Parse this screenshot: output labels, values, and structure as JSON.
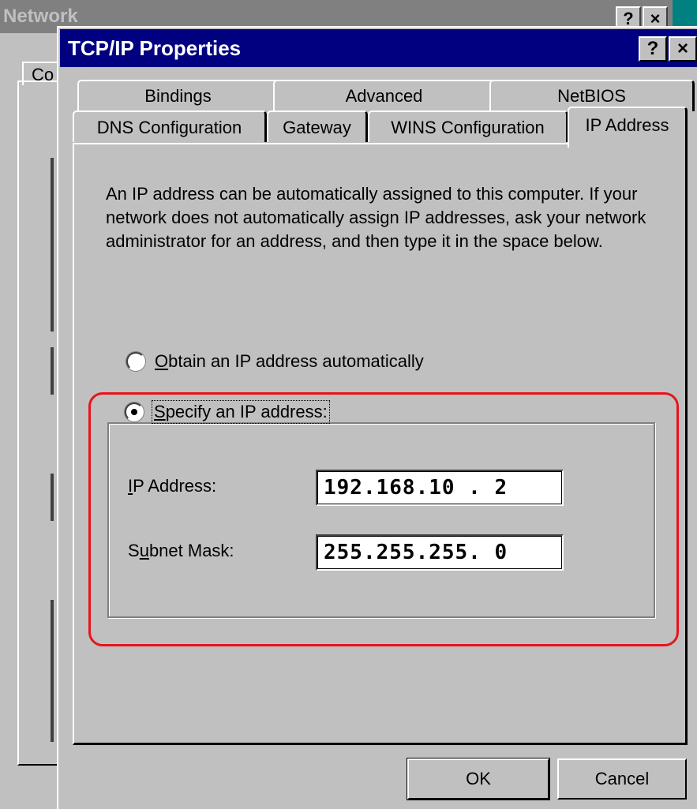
{
  "background_window": {
    "title": "Network",
    "buttons": [
      "?",
      "×"
    ],
    "tab_label": "Co"
  },
  "dialog": {
    "title": "TCP/IP Properties",
    "help_button": "?",
    "close_button": "×"
  },
  "tabs": {
    "row1": [
      "Bindings",
      "Advanced",
      "NetBIOS"
    ],
    "row2": [
      "DNS Configuration",
      "Gateway",
      "WINS Configuration"
    ],
    "active": "IP Address"
  },
  "intro_text": "An IP address can be automatically assigned to this computer. If your network does not automatically assign IP addresses, ask your network administrator for an address, and then type it in the space below.",
  "options": {
    "auto": {
      "accel": "O",
      "rest": "btain an IP address automatically",
      "selected": false
    },
    "specify": {
      "accel": "S",
      "rest": "pecify an IP address:",
      "selected": true
    }
  },
  "fields": {
    "ip_address": {
      "label_accel": "I",
      "label_rest": "P Address:",
      "value": "192.168.10 . 2"
    },
    "subnet_mask": {
      "label_pre": "S",
      "label_accel": "u",
      "label_rest": "bnet Mask:",
      "value": "255.255.255. 0"
    }
  },
  "buttons": {
    "ok": "OK",
    "cancel": "Cancel"
  },
  "colors": {
    "titlebar": "#000080",
    "highlight": "#e8141b",
    "face": "#c0c0c0",
    "desktop_strip": "#008080"
  }
}
